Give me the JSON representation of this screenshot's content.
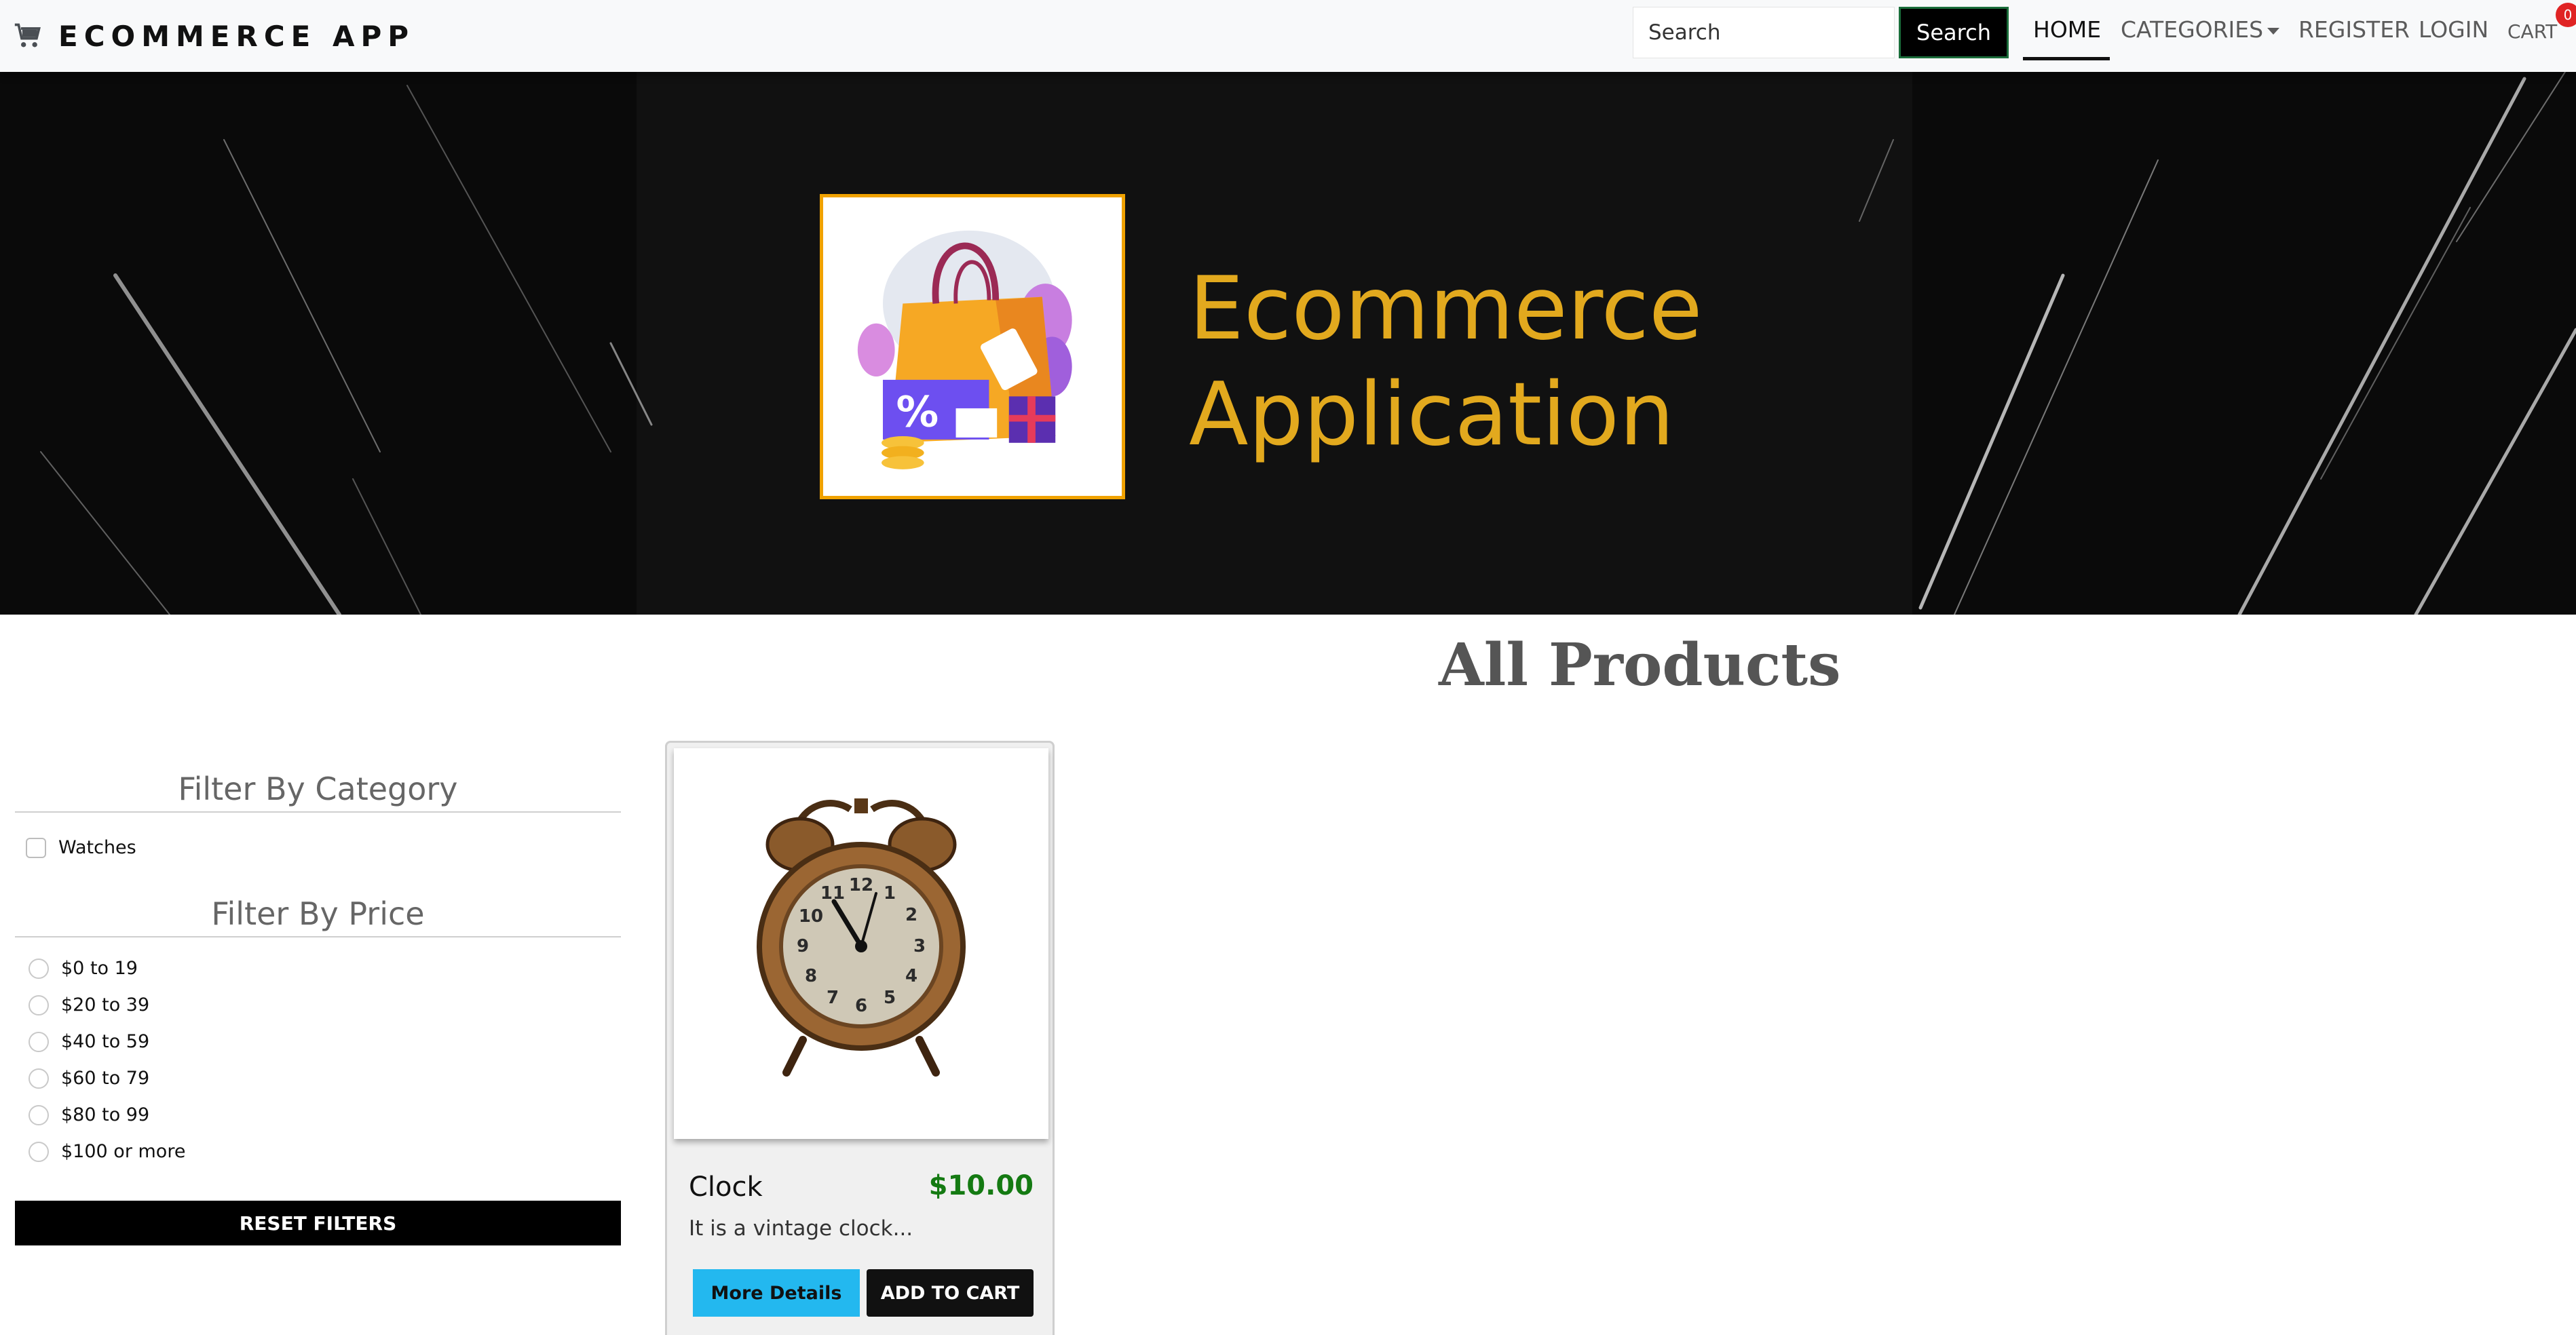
{
  "navbar": {
    "brand_icon": "shopping-cart-icon",
    "brand": "ECOMMERCE APP",
    "search_placeholder": "Search",
    "search_button": "Search",
    "links": {
      "home": "HOME",
      "categories": "CATEGORIES",
      "register": "REGISTER",
      "login": "LOGIN",
      "cart": "CART"
    },
    "cart_count": "0",
    "badge_color": "#e02424"
  },
  "banner": {
    "title_line1": "Ecommerce",
    "title_line2": "Application",
    "title_color": "#e2a91e",
    "logo_icon": "shopping-bag-illustration"
  },
  "main": {
    "heading": "All Products",
    "filters": {
      "category_title": "Filter By Category",
      "categories": [
        "Watches"
      ],
      "price_title": "Filter By Price",
      "prices": [
        "$0 to 19",
        "$20 to 39",
        "$40 to 59",
        "$60 to 79",
        "$80 to 99",
        "$100 or more"
      ],
      "reset_label": "RESET FILTERS"
    },
    "products": [
      {
        "name": "Clock",
        "price": "$10.00",
        "description": "It is a vintage clock...",
        "details_label": "More Details",
        "cart_label": "ADD TO CART",
        "image_icon": "alarm-clock-icon"
      }
    ]
  }
}
